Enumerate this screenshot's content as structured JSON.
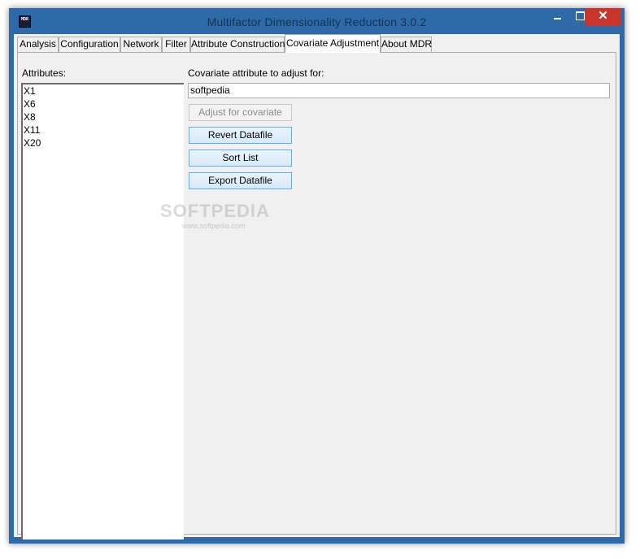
{
  "window": {
    "title": "Multifactor Dimensionality Reduction 3.0.2",
    "icon_text": "MDR",
    "minimize_glyph": "minimize-icon",
    "maximize_glyph": "maximize-icon",
    "close_glyph": "✕"
  },
  "tabs": [
    {
      "label": "Analysis"
    },
    {
      "label": "Configuration"
    },
    {
      "label": "Network"
    },
    {
      "label": "Filter"
    },
    {
      "label": "Attribute Construction"
    },
    {
      "label": "Covariate Adjustment"
    },
    {
      "label": "About MDR"
    }
  ],
  "active_tab": "Covariate Adjustment",
  "panel": {
    "attributes_label": "Attributes:",
    "attributes": [
      "X1",
      "X6",
      "X8",
      "X11",
      "X20"
    ],
    "covariate_label": "Covariate attribute to adjust for:",
    "covariate_value": "softpedia",
    "buttons": {
      "adjust": "Adjust for covariate",
      "revert": "Revert Datafile",
      "sort": "Sort List",
      "export": "Export Datafile"
    }
  },
  "watermark": {
    "main": "SOFTPEDIA",
    "sub": "www.softpedia.com"
  },
  "colors": {
    "title_bar": "#2f6aa8",
    "close_button": "#c7352b",
    "button_face": "#dcecfc",
    "button_border": "#7aa7d1"
  }
}
